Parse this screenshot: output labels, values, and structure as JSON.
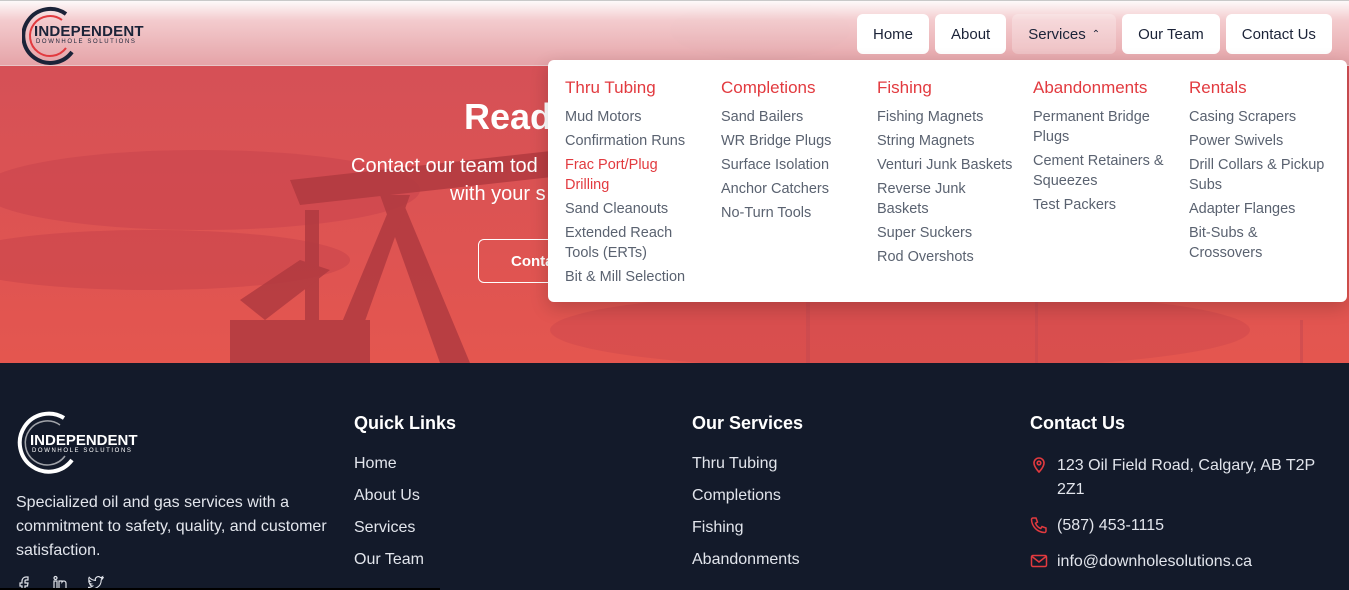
{
  "brand": {
    "word": "INDEPENDENT",
    "sub": "DOWNHOLE SOLUTIONS",
    "accent": "#e23a3f",
    "navy": "#1b2338"
  },
  "nav": [
    {
      "label": "Home"
    },
    {
      "label": "About"
    },
    {
      "label": "Services",
      "icon": "chevron-up-icon",
      "chev": "⌃"
    },
    {
      "label": "Our Team"
    },
    {
      "label": "Contact Us"
    }
  ],
  "hero": {
    "title": "Read",
    "sub_line1": "Contact our team tod",
    "sub_line2": "with your s",
    "cta": "Conta"
  },
  "dropdown": {
    "columns": [
      {
        "heading": "Thru Tubing",
        "items": [
          "Mud Motors",
          "Confirmation Runs",
          "Frac Port/Plug Drilling",
          "Sand Cleanouts",
          "Extended Reach Tools (ERTs)",
          "Bit & Mill Selection"
        ]
      },
      {
        "heading": "Completions",
        "items": [
          "Sand Bailers",
          "WR Bridge Plugs",
          "Surface Isolation",
          "Anchor Catchers",
          "No-Turn Tools"
        ]
      },
      {
        "heading": "Fishing",
        "items": [
          "Fishing Magnets",
          "String Magnets",
          "Venturi Junk Baskets",
          "Reverse Junk Baskets",
          "Super Suckers",
          "Rod Overshots"
        ]
      },
      {
        "heading": "Abandonments",
        "items": [
          "Permanent Bridge Plugs",
          "Cement Retainers & Squeezes",
          "Test Packers"
        ]
      },
      {
        "heading": "Rentals",
        "items": [
          "Casing Scrapers",
          "Power Swivels",
          "Drill Collars & Pickup Subs",
          "Adapter Flanges",
          "Bit-Subs & Crossovers"
        ]
      }
    ]
  },
  "footer": {
    "description": "Specialized oil and gas services with a commitment to safety, quality, and customer satisfaction.",
    "quick_links": {
      "heading": "Quick Links",
      "items": [
        "Home",
        "About Us",
        "Services",
        "Our Team"
      ]
    },
    "our_services": {
      "heading": "Our Services",
      "items": [
        "Thru Tubing",
        "Completions",
        "Fishing",
        "Abandonments"
      ]
    },
    "contact": {
      "heading": "Contact Us",
      "address": "123 Oil Field Road, Calgary, AB T2P 2Z1",
      "phone": "(587) 453-1115",
      "email": "info@downholesolutions.ca"
    }
  }
}
